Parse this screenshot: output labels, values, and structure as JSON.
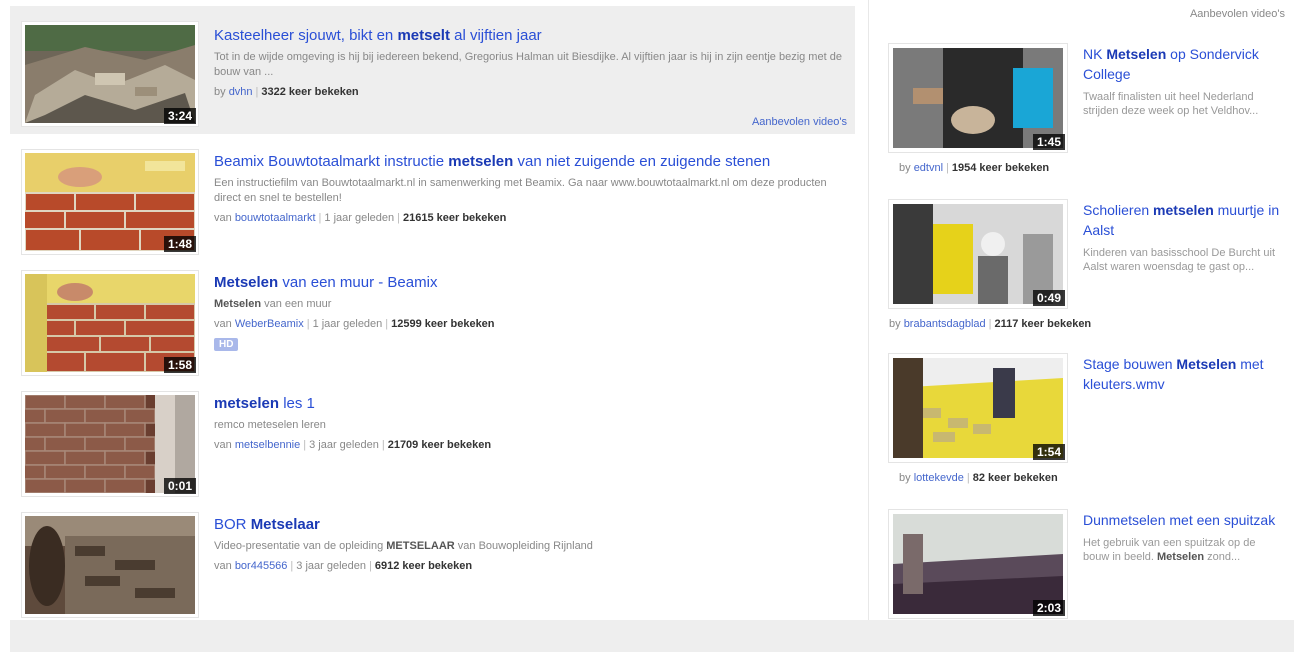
{
  "main": {
    "results": [
      {
        "title_pre": "Kasteelheer sjouwt, bikt en ",
        "title_bold": "metselt",
        "title_post": " al vijftien jaar",
        "desc": "Tot in de wijde omgeving is hij bij iedereen bekend, Gregorius Halman uit Biesdijke. Al vijftien jaar is hij in zijn eentje bezig met de bouw van ...",
        "by_label": "by",
        "channel": "dvhn",
        "age": "",
        "views": "3322 keer bekeken",
        "duration": "3:24",
        "recommended_link": "Aanbevolen video's",
        "thumb_colors": [
          "#8a7d6c",
          "#5d574d",
          "#b5ab98",
          "#3f5d3a"
        ]
      },
      {
        "title_pre": "Beamix Bouwtotaalmarkt instructie ",
        "title_bold": "metselen",
        "title_post": " van niet zuigende en zuigende stenen",
        "desc": "Een instructiefilm van Bouwtotaalmarkt.nl in samenwerking met Beamix. Ga naar www.bouwtotaalmarkt.nl om deze producten direct en snel te bestellen!",
        "by_label": "van",
        "channel": "bouwtotaalmarkt",
        "age": "1 jaar geleden",
        "views": "21615 keer bekeken",
        "duration": "1:48",
        "thumb_colors": [
          "#e8cf6a",
          "#b84a2a",
          "#d9b24d",
          "#8a2d1b"
        ]
      },
      {
        "title_pre": "",
        "title_bold": "Metselen",
        "title_post": " van een muur - Beamix",
        "desc_bold": "Metselen",
        "desc": " van een muur",
        "by_label": "van",
        "channel": "WeberBeamix",
        "age": "1 jaar geleden",
        "views": "12599 keer bekeken",
        "duration": "1:58",
        "badge": "HD",
        "thumb_colors": [
          "#e8d66a",
          "#b44a30",
          "#d8c45a",
          "#8c3220"
        ]
      },
      {
        "title_pre": "",
        "title_bold": "metselen",
        "title_post": " les 1",
        "desc": "remco meteselen leren",
        "by_label": "van",
        "channel": "metselbennie",
        "age": "3 jaar geleden",
        "views": "21709 keer bekeken",
        "duration": "0:01",
        "thumb_colors": [
          "#8c5a48",
          "#6a3e30",
          "#a87a66",
          "#d8d0c8"
        ]
      },
      {
        "title_pre": "BOR ",
        "title_bold": "Metselaar",
        "title_post": "",
        "desc_pre": "Video-presentatie van de opleiding ",
        "desc_bold": "METSELAAR",
        "desc": " van Bouwopleiding Rijnland",
        "by_label": "van",
        "channel": "bor445566",
        "age": "3 jaar geleden",
        "views": "6912 keer bekeken",
        "duration": "",
        "thumb_colors": [
          "#7a6a5a",
          "#4a3c30",
          "#9a8a78",
          "#5e4a3c"
        ]
      }
    ]
  },
  "sidebar": {
    "heading": "Aanbevolen video's",
    "items": [
      {
        "title_pre": "NK ",
        "title_bold": "Metselen",
        "title_post": " op Sondervick College",
        "desc": "Twaalf finalisten uit heel Nederland strijden deze week op het Veldhov...",
        "channel": "edtvnl",
        "views": "1954 keer bekeken",
        "duration": "1:45",
        "thumb_colors": [
          "#2a2a2a",
          "#1aa6d6",
          "#7a7a7a",
          "#c8b49a"
        ]
      },
      {
        "title_pre": "Scholieren ",
        "title_bold": "metselen",
        "title_post": " muurtje in Aalst",
        "desc": "Kinderen van basisschool De Burcht uit Aalst waren woensdag te gast op...",
        "channel": "brabantsdagblad",
        "views": "2117 keer bekeken",
        "duration": "0:49",
        "thumb_colors": [
          "#3a3a3a",
          "#e6d21a",
          "#d8d8d8",
          "#6a6a6a"
        ]
      },
      {
        "title_pre": "Stage bouwen ",
        "title_bold": "Metselen",
        "title_post": " met kleuters.wmv",
        "desc": "",
        "channel": "lottekevde",
        "views": "82 keer bekeken",
        "duration": "1:54",
        "thumb_colors": [
          "#e8d83a",
          "#c8b870",
          "#4a3a2a",
          "#eeeeee"
        ]
      },
      {
        "title_pre": "Dunmetselen met een spuitzak",
        "title_bold": "",
        "title_post": "",
        "desc_pre": "Het gebruik van een spuitzak op de bouw in beeld. ",
        "desc_bold": "Metselen",
        "desc": " zond...",
        "channel": "",
        "views": "",
        "duration": "2:03",
        "thumb_colors": [
          "#d8dcd8",
          "#5a4a5a",
          "#3a2a3a",
          "#7a6a6a"
        ]
      }
    ]
  }
}
